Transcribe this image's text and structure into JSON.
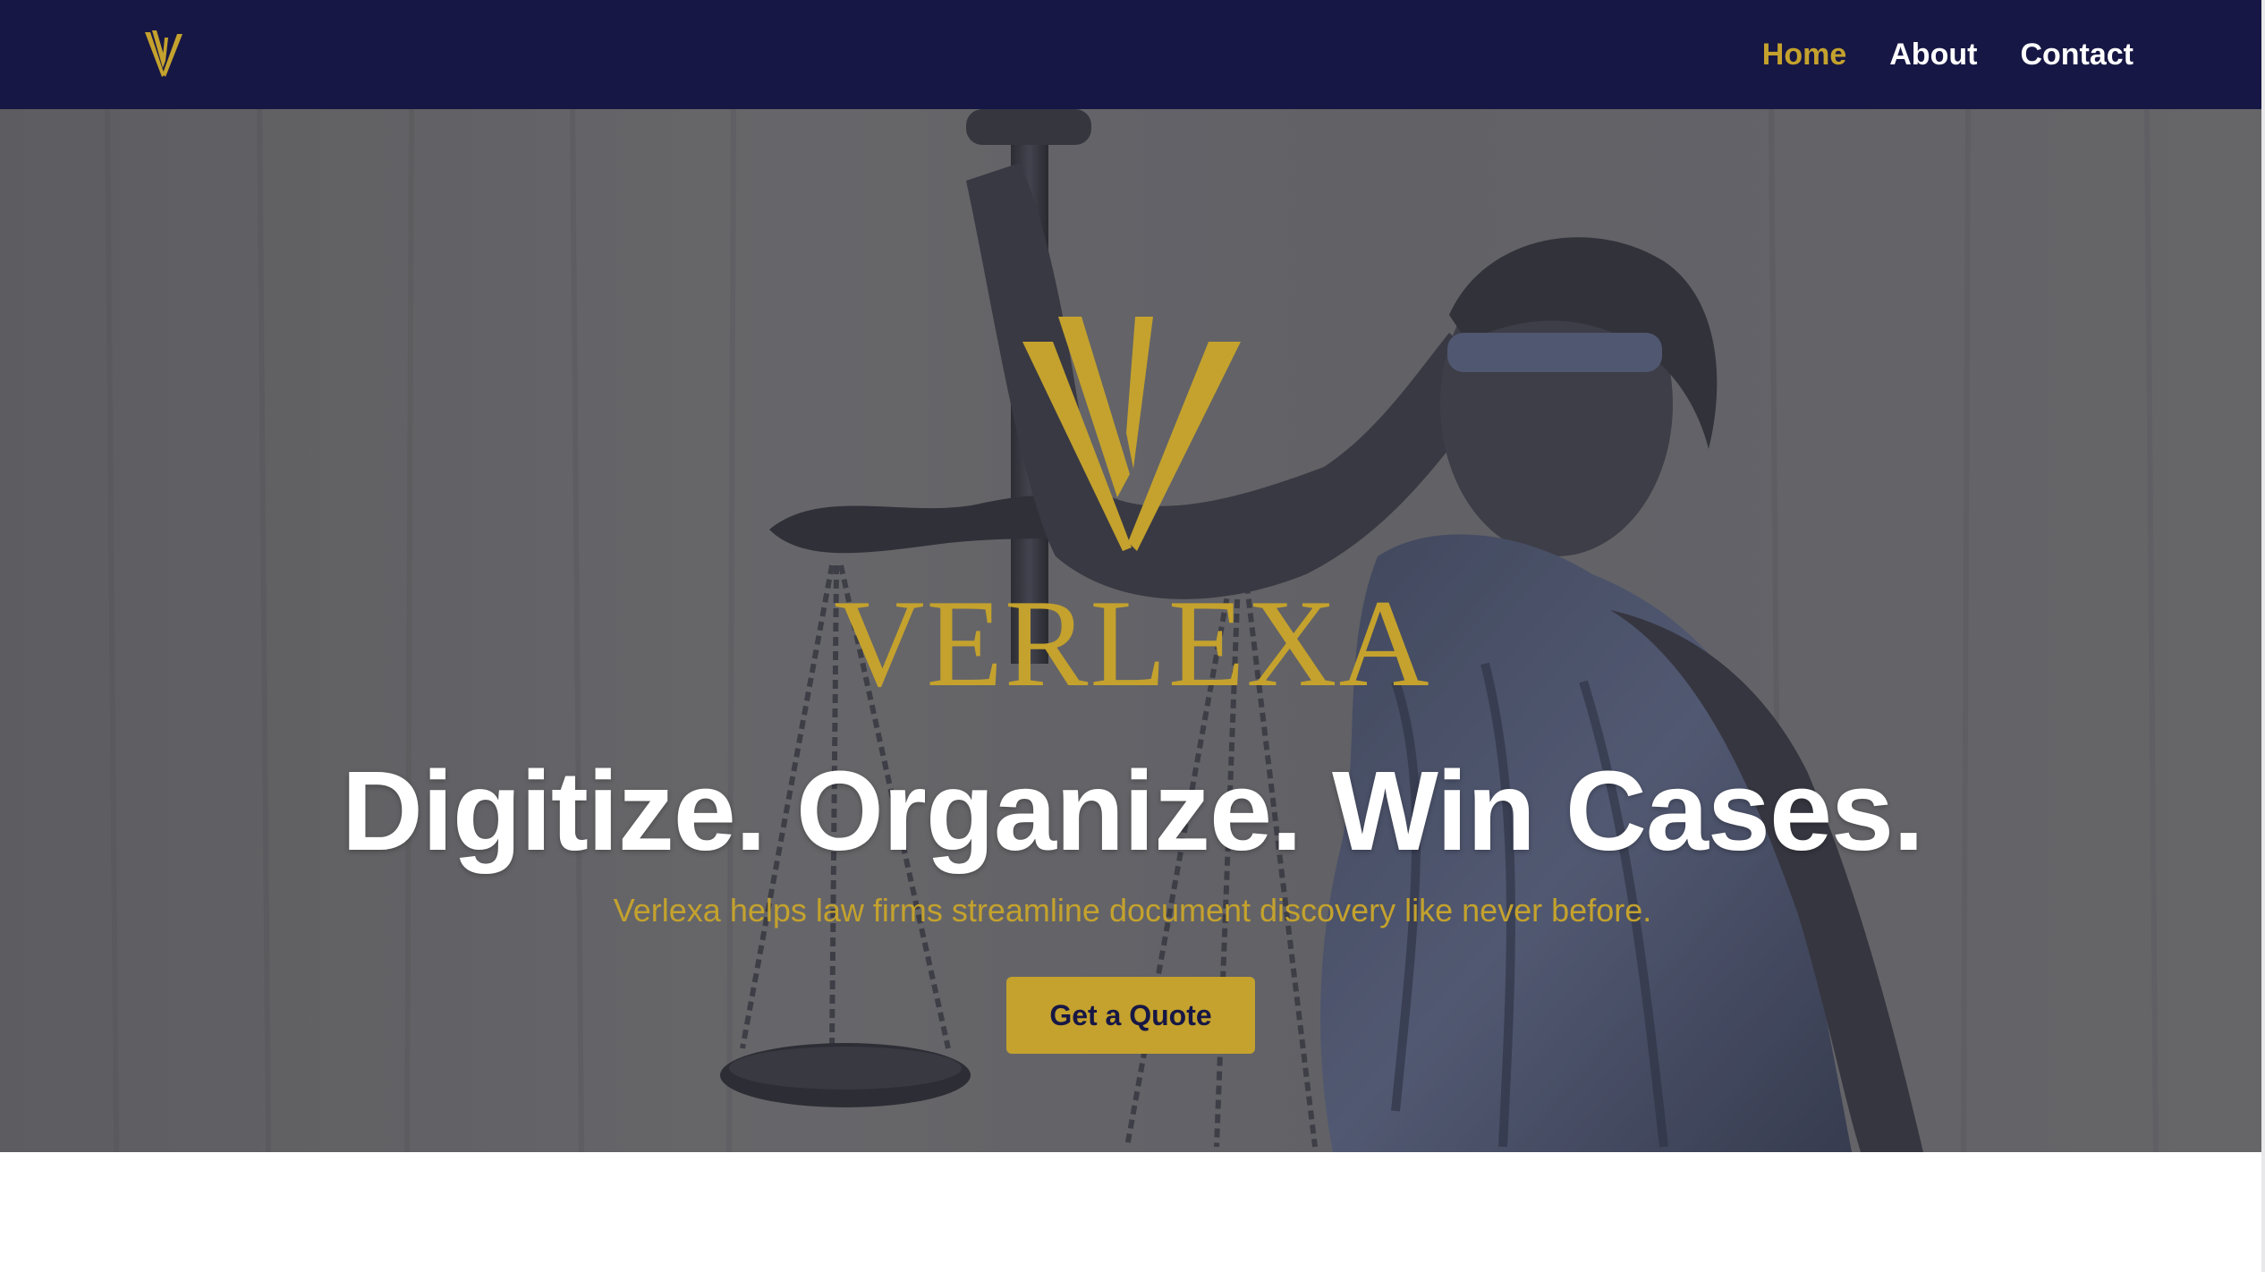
{
  "nav": {
    "logo_icon": "verlexa-v-logo-icon",
    "links": [
      {
        "label": "Home",
        "active": true
      },
      {
        "label": "About",
        "active": false
      },
      {
        "label": "Contact",
        "active": false
      }
    ]
  },
  "hero": {
    "background": "lady-justice-statue-photo",
    "logo_icon": "verlexa-v-logo-icon",
    "wordmark": "VERLEXA",
    "headline": "Digitize. Organize. Win Cases.",
    "subtitle": "Verlexa helps law firms streamline document discovery like never before.",
    "cta_label": "Get a Quote"
  },
  "colors": {
    "navy": "#171745",
    "gold": "#c4a22d",
    "white": "#ffffff"
  }
}
